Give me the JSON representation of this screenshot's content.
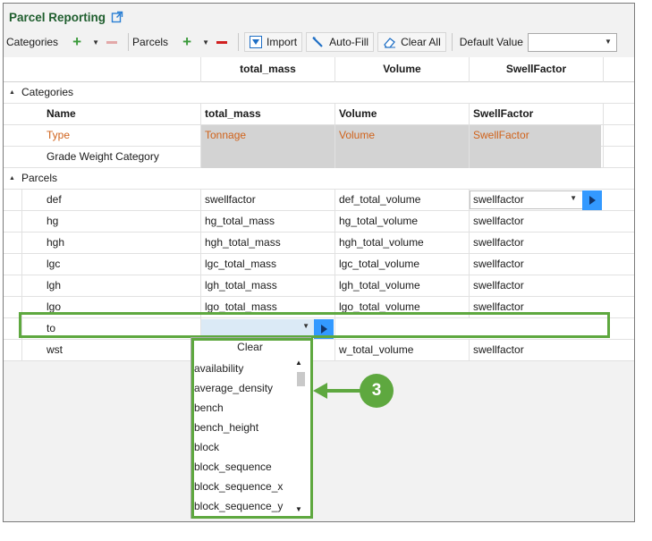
{
  "window": {
    "title": "Parcel Reporting",
    "title_icon": "external-link-icon"
  },
  "toolbar": {
    "categories_label": "Categories",
    "parcels_label": "Parcels",
    "import_label": "Import",
    "autofill_label": "Auto-Fill",
    "clear_all_label": "Clear All",
    "default_value_label": "Default Value",
    "default_value": ""
  },
  "columns": [
    "total_mass",
    "Volume",
    "SwellFactor"
  ],
  "categories": {
    "section_label": "Categories",
    "header": {
      "name": "Name",
      "c1": "total_mass",
      "c2": "Volume",
      "c3": "SwellFactor"
    },
    "type_row": {
      "name": "Type",
      "c1": "Tonnage",
      "c2": "Volume",
      "c3": "SwellFactor"
    },
    "grade_row": {
      "name": "Grade Weight Category"
    }
  },
  "parcels": {
    "section_label": "Parcels",
    "rows": [
      {
        "name": "def",
        "c1": "swellfactor",
        "c2": "def_total_volume",
        "c3": "swellfactor"
      },
      {
        "name": "hg",
        "c1": "hg_total_mass",
        "c2": "hg_total_volume",
        "c3": "swellfactor"
      },
      {
        "name": "hgh",
        "c1": "hgh_total_mass",
        "c2": "hgh_total_volume",
        "c3": "swellfactor"
      },
      {
        "name": "lgc",
        "c1": "lgc_total_mass",
        "c2": "lgc_total_volume",
        "c3": "swellfactor"
      },
      {
        "name": "lgh",
        "c1": "lgh_total_mass",
        "c2": "lgh_total_volume",
        "c3": "swellfactor"
      },
      {
        "name": "lgo",
        "c1": "lgo_total_mass",
        "c2": "lgo_total_volume",
        "c3": "swellfactor"
      },
      {
        "name": "to",
        "c1": "",
        "c2": "",
        "c3": ""
      },
      {
        "name": "wst",
        "c1": "",
        "c2": "w_total_volume",
        "c3": "swellfactor"
      }
    ]
  },
  "dropdown": {
    "clear_label": "Clear",
    "options": [
      "availability",
      "average_density",
      "bench",
      "bench_height",
      "block",
      "block_sequence",
      "block_sequence_x",
      "block_sequence_y"
    ]
  },
  "callout": {
    "number": "3"
  },
  "colors": {
    "accent_green": "#5ea83f",
    "title_green": "#1f5e2e",
    "orange_text": "#d0621a",
    "blue_button": "#3399ff"
  }
}
